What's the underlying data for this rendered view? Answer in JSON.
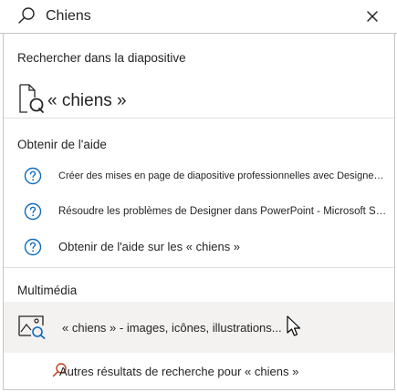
{
  "search": {
    "query": "Chiens",
    "icon": "search-icon",
    "close_icon": "close-icon"
  },
  "sections": {
    "slide_search": {
      "header": "Rechercher dans la diapositive",
      "result": "« chiens »",
      "icon": "slide-search-icon"
    },
    "help": {
      "header": "Obtenir de l'aide",
      "items": [
        {
          "label": "Créer des mises en page de diapositive professionnelles avec Designer - Micro",
          "icon": "question-circle-icon"
        },
        {
          "label": "Résoudre les problèmes de Designer dans PowerPoint - Microsoft Su...",
          "icon": "question-circle-icon"
        },
        {
          "label": "Obtenir de l'aide sur les « chiens »",
          "icon": "question-circle-icon"
        }
      ]
    },
    "media": {
      "header": "Multimédia",
      "item": "« chiens » - images, icônes, illustrations...",
      "icon": "image-search-icon"
    },
    "more": {
      "label": "Autres résultats de recherche pour « chiens »",
      "icon": "search-icon"
    }
  },
  "colors": {
    "accent": "#0f6cbd",
    "search_orange": "#c43e1c",
    "hover_bg": "#f3f2f1",
    "divider": "#e1dfdd"
  }
}
